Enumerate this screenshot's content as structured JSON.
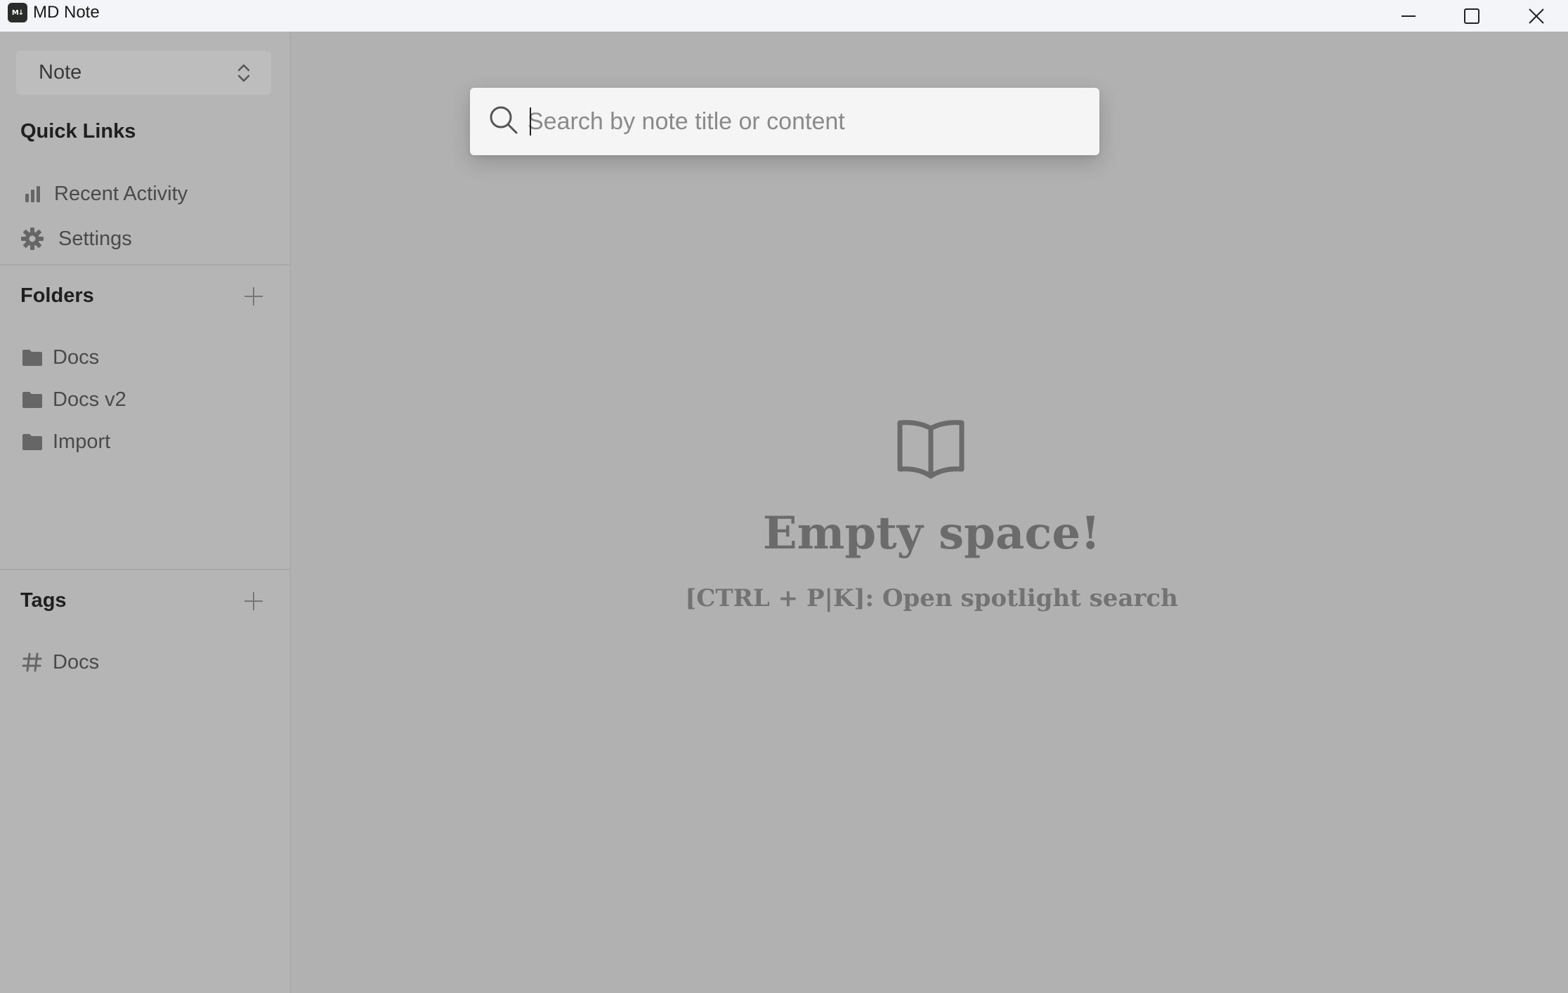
{
  "window": {
    "logo_text": "M↓",
    "title": "MD Note",
    "controls": [
      "minimize",
      "maximize",
      "close"
    ]
  },
  "sidebar": {
    "mode_select": {
      "value": "Note"
    },
    "quick_links": {
      "title": "Quick Links",
      "items": [
        {
          "label": "Recent Activity",
          "icon": "bar-chart-icon"
        },
        {
          "label": "Settings",
          "icon": "gear-icon"
        }
      ]
    },
    "folders": {
      "title": "Folders",
      "items": [
        {
          "label": "Docs",
          "icon": "folder-icon"
        },
        {
          "label": "Docs v2",
          "icon": "folder-icon"
        },
        {
          "label": "Import",
          "icon": "folder-icon"
        }
      ]
    },
    "tags": {
      "title": "Tags",
      "items": [
        {
          "label": "Docs",
          "icon": "hash-icon"
        }
      ]
    }
  },
  "search": {
    "placeholder": "Search by note title or content",
    "value": ""
  },
  "empty_state": {
    "icon": "book-open-icon",
    "title": "Empty space!",
    "hint": "[CTRL + P|K]: Open spotlight search"
  },
  "colors": {
    "titlebar_bg": "#f3f5f8",
    "overlay_bg": "#b1b1b1",
    "search_bg": "#f5f5f5",
    "muted_text": "#6b6b6b"
  }
}
